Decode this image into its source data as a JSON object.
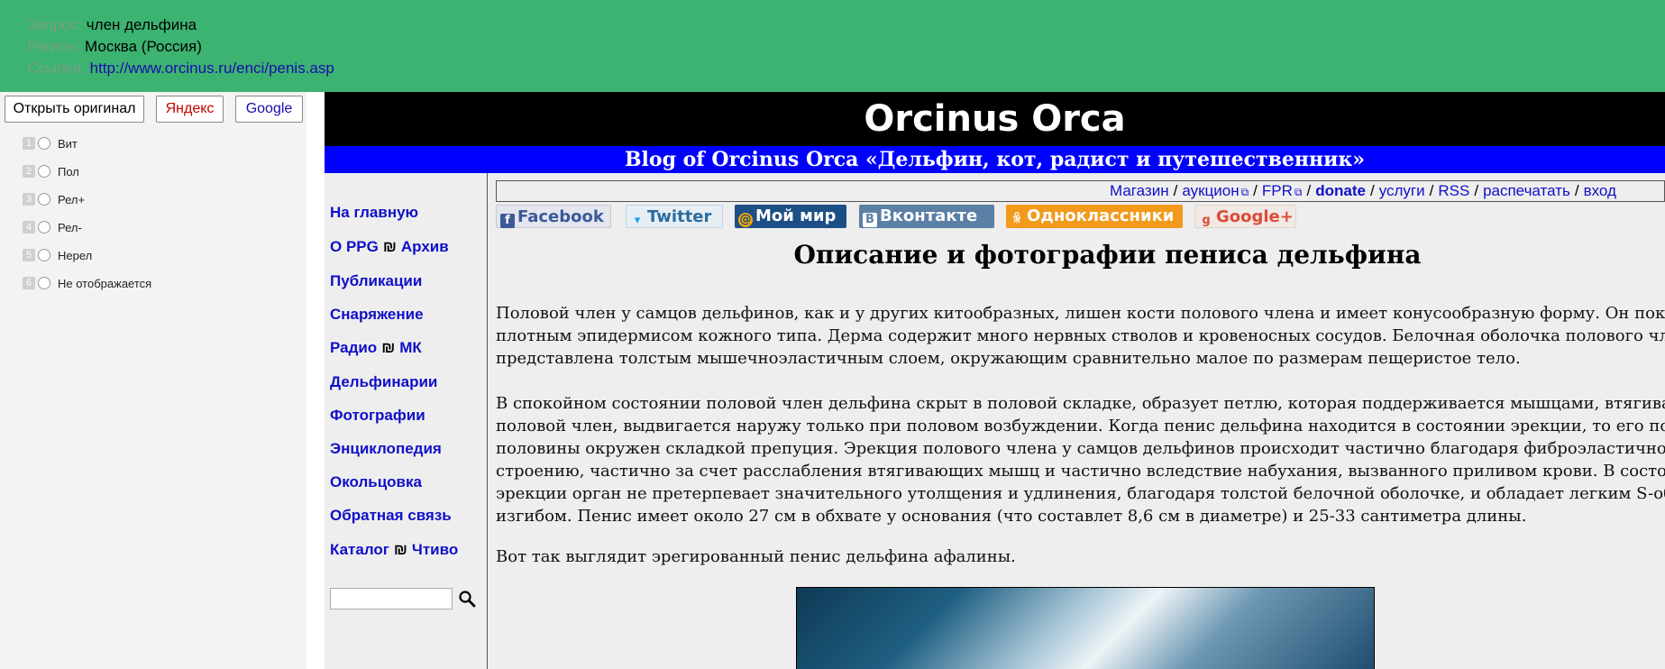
{
  "header": {
    "query_label": "Запрос:",
    "query_value": "член дельфина",
    "region_label": "Регион:",
    "region_value": "Москва (Россия)",
    "link_label": "Ссылка:",
    "link_value": "http://www.orcinus.ru/enci/penis.asp"
  },
  "buttons": {
    "open_original": "Открыть оригинал",
    "yandex": "Яндекс",
    "google": "Google"
  },
  "options": [
    {
      "num": "1",
      "label": "Вит"
    },
    {
      "num": "2",
      "label": "Пол"
    },
    {
      "num": "3",
      "label": "Рел+"
    },
    {
      "num": "4",
      "label": "Рел-"
    },
    {
      "num": "5",
      "label": "Нерел"
    },
    {
      "num": "6",
      "label": "Не отображается"
    }
  ],
  "colors": {
    "header_bg": "#3cb371",
    "yandex_red": "#cc0000",
    "google_blue": "#1a0dab",
    "site_title_bg": "#000000",
    "site_subtitle_bg": "#0000ff",
    "nav_link": "#1010c8"
  },
  "site": {
    "title": "Orcinus Orca",
    "subtitle": "Blog of Orcinus Orca «Дельфин, кот, радист и путешественник»",
    "nav": [
      {
        "a": "На главную"
      },
      {
        "a": "О PPG",
        "sep": "₪",
        "b": "Архив"
      },
      {
        "a": "Публикации"
      },
      {
        "a": "Снаряжение"
      },
      {
        "a": "Радио",
        "sep": "₪",
        "b": "МК"
      },
      {
        "a": "Дельфинарии"
      },
      {
        "a": "Фотографии"
      },
      {
        "a": "Энциклопедия"
      },
      {
        "a": "Окольцовка"
      },
      {
        "a": "Обратная связь"
      },
      {
        "a": "Каталог",
        "sep": "₪",
        "b": "Чтиво"
      }
    ],
    "topmenu": [
      "Магазин",
      "аукцион",
      "FPR",
      "donate",
      "услуги",
      "RSS",
      "распечатать",
      "вход"
    ],
    "social": [
      "Facebook",
      "Twitter",
      "Мой мир",
      "Вконтакте",
      "Одноклассники",
      "Google+"
    ],
    "heading": "Описание и фотографии пениса дельфина",
    "paragraphs": [
      [
        "Половой член у самцов дельфинов, как и у других китообразных, лишен кости полового члена и имеет конусообразную форму. Он покры",
        "плотным эпидермисом кожного типа. Дерма содержит много нервных стволов и кровеносных сосудов. Белочная оболочка полового член",
        "представлена толстым мышечноэластичным слоем, окружающим сравнительно малое по размерам пещеристое тело."
      ],
      [
        "В спокойном состоянии половой член дельфина скрыт в половой складке, образует петлю, которая поддерживается мышцами, втягивающим",
        "половой член, выдвигается наружу только при половом возбуждении. Когда пенис дельфина находится в состоянии эрекции, то его почти д",
        "половины окружен складкой препуция. Эрекция полового члена у самцов дельфинов происходит частично благодаря фиброэластичном",
        "строению, частично за счет расслабления втягивающих мышц и частично вследствие набухания, вызванного приливом крови. В состояни",
        "эрекции орган не претерпевает значительного утолщения и удлинения, благодаря толстой белочной оболочке, и обладает легким S-образны",
        "изгибом. Пенис имеет около 27 см в обхвате у основания (что составлет 8,6 см в диаметре) и 25-33 сантиметра длины."
      ],
      [
        "Вот так выглядит эрегированный пенис дельфина афалины."
      ]
    ]
  }
}
